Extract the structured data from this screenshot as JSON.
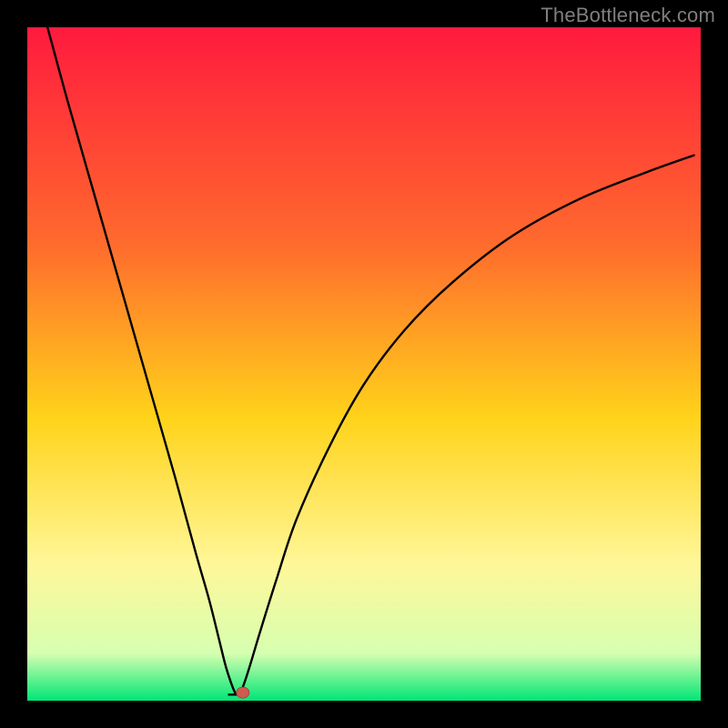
{
  "watermark": "TheBottleneck.com",
  "colors": {
    "frame": "#000000",
    "curve": "#000000",
    "marker_fill": "#cf5a50",
    "marker_stroke": "#a8443c",
    "grad_top": "#ff1a3e",
    "grad_mid_upper": "#ff6a2d",
    "grad_mid": "#ffd31a",
    "grad_lower": "#fff79a",
    "grad_near_bottom": "#d6ffb0",
    "grad_bottom": "#00e676"
  },
  "chart_data": {
    "type": "line",
    "title": "",
    "xlabel": "",
    "ylabel": "",
    "xlim": [
      0,
      100
    ],
    "ylim": [
      0,
      100
    ],
    "series": [
      {
        "name": "bottleneck-curve",
        "x": [
          3,
          6,
          10,
          14,
          18,
          22,
          25,
          27,
          28.5,
          29.5,
          30.5,
          31,
          31.5,
          32,
          33,
          34.5,
          37,
          40,
          45,
          50,
          56,
          63,
          72,
          82,
          92,
          99
        ],
        "y": [
          100,
          89,
          75,
          61,
          47,
          33,
          22,
          15,
          9,
          5,
          2,
          1,
          1,
          2,
          5,
          10,
          18,
          27,
          38,
          47,
          55,
          62,
          69,
          74.5,
          78.5,
          81
        ]
      }
    ],
    "marker": {
      "x": 32,
      "y": 1.2,
      "r": 1.0
    },
    "flat_segment": {
      "x0": 29.8,
      "x1": 32.3,
      "y": 0.9
    }
  }
}
